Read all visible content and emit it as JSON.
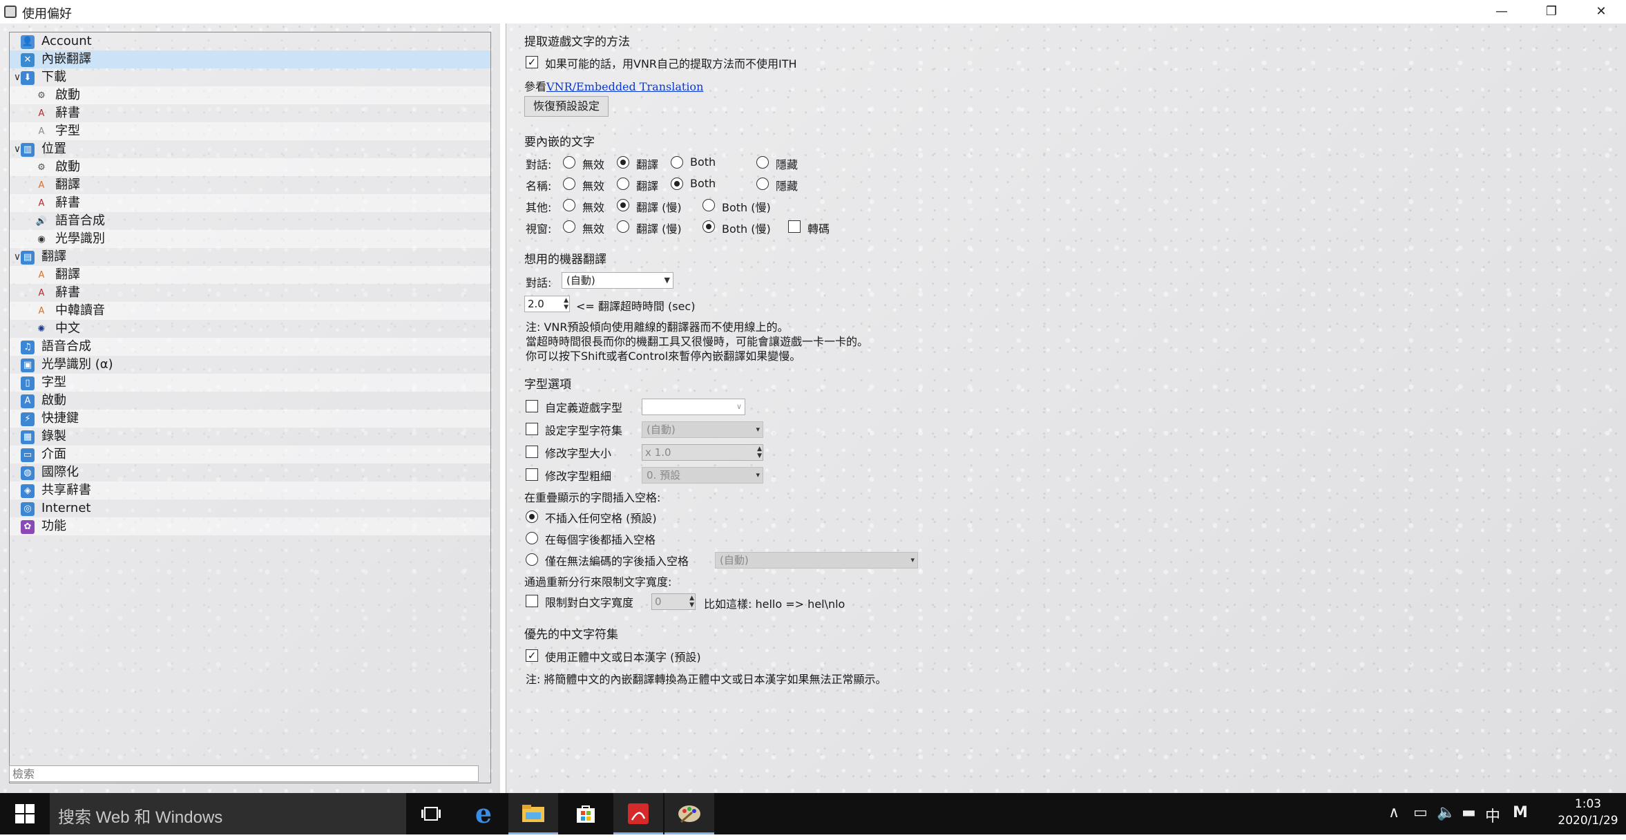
{
  "window": {
    "title": "使用偏好",
    "minimize": "—",
    "restore": "❐",
    "close": "✕"
  },
  "tree": {
    "items": [
      {
        "label": "Account",
        "icon": "account-icon",
        "glyph": "👤",
        "color": "#4a8fd6",
        "level": 0,
        "twisty": ""
      },
      {
        "label": "內嵌翻譯",
        "icon": "embed-translate-icon",
        "glyph": "✕",
        "color": "#3a8ad2",
        "level": 0,
        "twisty": "",
        "selected": true
      },
      {
        "label": "下載",
        "icon": "download-icon",
        "glyph": "⬇",
        "color": "#3c86d4",
        "level": 0,
        "twisty": "∨"
      },
      {
        "label": "啟動",
        "icon": "launch-icon",
        "glyph": "⚙",
        "color": "#555555",
        "level": 1,
        "twisty": ""
      },
      {
        "label": "辭書",
        "icon": "dictionary-icon",
        "glyph": "A",
        "color": "#b52a2a",
        "level": 1,
        "twisty": ""
      },
      {
        "label": "字型",
        "icon": "font-icon",
        "glyph": "A",
        "color": "#8a8a8a",
        "level": 1,
        "twisty": ""
      },
      {
        "label": "位置",
        "icon": "location-icon",
        "glyph": "▥",
        "color": "#3c86d4",
        "level": 0,
        "twisty": "∨"
      },
      {
        "label": "啟動",
        "icon": "launch-icon",
        "glyph": "⚙",
        "color": "#555555",
        "level": 1,
        "twisty": ""
      },
      {
        "label": "翻譯",
        "icon": "translate-icon",
        "glyph": "A",
        "color": "#d6712b",
        "level": 1,
        "twisty": ""
      },
      {
        "label": "辭書",
        "icon": "dictionary-icon",
        "glyph": "A",
        "color": "#b52a2a",
        "level": 1,
        "twisty": ""
      },
      {
        "label": "語音合成",
        "icon": "speaker-icon",
        "glyph": "🔊",
        "color": "#333333",
        "level": 1,
        "twisty": ""
      },
      {
        "label": "光學識別",
        "icon": "ocr-icon",
        "glyph": "◉",
        "color": "#333333",
        "level": 1,
        "twisty": ""
      },
      {
        "label": "翻譯",
        "icon": "translate-folder-icon",
        "glyph": "▤",
        "color": "#3c86d4",
        "level": 0,
        "twisty": "∨"
      },
      {
        "label": "翻譯",
        "icon": "translate-icon",
        "glyph": "A",
        "color": "#d6712b",
        "level": 1,
        "twisty": ""
      },
      {
        "label": "辭書",
        "icon": "dictionary-icon",
        "glyph": "A",
        "color": "#b52a2a",
        "level": 1,
        "twisty": ""
      },
      {
        "label": "中韓讀音",
        "icon": "reading-icon",
        "glyph": "A",
        "color": "#d6712b",
        "level": 1,
        "twisty": ""
      },
      {
        "label": "中文",
        "icon": "chinese-icon",
        "glyph": "✺",
        "color": "#1a3a8a",
        "level": 1,
        "twisty": ""
      },
      {
        "label": "語音合成",
        "icon": "tts-icon",
        "glyph": "♫",
        "color": "#3c86d4",
        "level": 0,
        "twisty": ""
      },
      {
        "label": "光學識別 (α)",
        "icon": "ocr-folder-icon",
        "glyph": "▣",
        "color": "#3c86d4",
        "level": 0,
        "twisty": ""
      },
      {
        "label": "字型",
        "icon": "font-folder-icon",
        "glyph": "▯",
        "color": "#3c86d4",
        "level": 0,
        "twisty": ""
      },
      {
        "label": "啟動",
        "icon": "launch-folder-icon",
        "glyph": "A",
        "color": "#3c86d4",
        "level": 0,
        "twisty": ""
      },
      {
        "label": "快捷鍵",
        "icon": "shortcut-icon",
        "glyph": "⚡",
        "color": "#3c86d4",
        "level": 0,
        "twisty": ""
      },
      {
        "label": "錄製",
        "icon": "record-icon",
        "glyph": "▦",
        "color": "#3c86d4",
        "level": 0,
        "twisty": ""
      },
      {
        "label": "介面",
        "icon": "interface-icon",
        "glyph": "▭",
        "color": "#3c86d4",
        "level": 0,
        "twisty": ""
      },
      {
        "label": "國際化",
        "icon": "globe-icon",
        "glyph": "◍",
        "color": "#3c86d4",
        "level": 0,
        "twisty": ""
      },
      {
        "label": "共享辭書",
        "icon": "shared-dictionary-icon",
        "glyph": "◈",
        "color": "#3c86d4",
        "level": 0,
        "twisty": ""
      },
      {
        "label": "Internet",
        "icon": "internet-icon",
        "glyph": "◎",
        "color": "#3c86d4",
        "level": 0,
        "twisty": ""
      },
      {
        "label": "功能",
        "icon": "features-icon",
        "glyph": "✿",
        "color": "#8a4ab5",
        "level": 0,
        "twisty": ""
      }
    ],
    "search_placeholder": "檢索"
  },
  "extract": {
    "header": "提取遊戲文字的方法",
    "use_vnr_label": "如果可能的話，用VNR自己的提取方法而不使用ITH",
    "use_vnr_checked": true,
    "see_prefix": "參看",
    "see_link": "VNR/Embedded Translation",
    "reset_button": "恢復預設設定"
  },
  "embed_text": {
    "header": "要內嵌的文字",
    "rows": [
      {
        "label": "對話:",
        "options": [
          "無效",
          "翻譯",
          "Both",
          "隱藏"
        ],
        "selected": 1
      },
      {
        "label": "名稱:",
        "options": [
          "無效",
          "翻譯",
          "Both",
          "隱藏"
        ],
        "selected": 2
      },
      {
        "label": "其他:",
        "options": [
          "無效",
          "翻譯 (慢)",
          "Both (慢)"
        ],
        "selected": 1
      },
      {
        "label": "視窗:",
        "options": [
          "無效",
          "翻譯 (慢)",
          "Both (慢)"
        ],
        "selected": 2,
        "extra_checkbox": "轉碼"
      }
    ]
  },
  "machine": {
    "header": "想用的機器翻譯",
    "dialog_label": "對話:",
    "dialog_value": "(自動)",
    "timeout_value": "2.0",
    "timeout_label": "<= 翻譯超時時間 (sec)",
    "note1": "注: VNR預設傾向使用離線的翻譯器而不使用線上的。",
    "note2": "當超時時間很長而你的機翻工具又很慢時，可能會讓遊戲一卡一卡的。",
    "note3": "你可以按下Shift或者Control來暫停內嵌翻譯如果變慢。"
  },
  "font": {
    "header": "字型選項",
    "custom_font_label": "自定義遊戲字型",
    "custom_font_value": "",
    "charset_label": "設定字型字符集",
    "charset_value": "(自動)",
    "size_label": "修改字型大小",
    "size_value": "x 1.0",
    "weight_label": "修改字型粗細",
    "weight_value": "0. 預設",
    "space_header": "在重疊顯示的字間插入空格:",
    "space_opt1": "不插入任何空格 (預設)",
    "space_opt2": "在每個字後都插入空格",
    "space_opt3": "僅在無法編碼的字後插入空格",
    "space_opt3_value": "(自動)",
    "space_selected": 1,
    "width_header": "通過重新分行來限制文字寬度:",
    "width_label": "限制對白文字寬度",
    "width_value": "0",
    "width_example": "比如這樣: hello => hel\\nlo"
  },
  "charset": {
    "header": "優先的中文字符集",
    "option_label": "使用正體中文或日本漢字 (預設)",
    "option_checked": true,
    "note": "注: 將簡體中文的內嵌翻譯轉換為正體中文或日本漢字如果無法正常顯示。"
  },
  "taskbar": {
    "search_text": "搜索 Web 和 Windows",
    "ime": "中",
    "tray_m": "M",
    "time": "1:03",
    "date": "2020/1/29"
  }
}
